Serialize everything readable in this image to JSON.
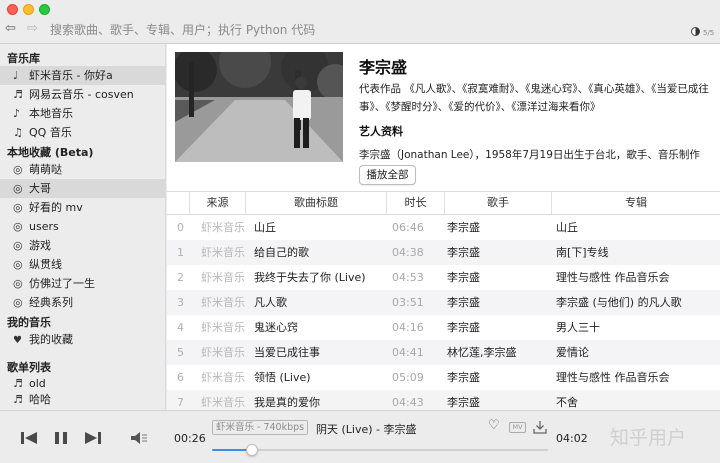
{
  "search": {
    "placeholder": "搜索歌曲、歌手、专辑、用户；执行 Python 代码"
  },
  "toolbar": {
    "page_counter": "5/5"
  },
  "sidebar": {
    "sections": [
      {
        "title": "音乐库",
        "items": [
          {
            "icon": "♩",
            "label": "虾米音乐 - 你好a",
            "selected": true
          },
          {
            "icon": "♬",
            "label": "网易云音乐 - cosven",
            "selected": false
          },
          {
            "icon": "♪",
            "label": "本地音乐",
            "selected": false
          },
          {
            "icon": "♫",
            "label": "QQ 音乐",
            "selected": false
          }
        ]
      },
      {
        "title": "本地收藏 (Beta)",
        "items": [
          {
            "icon": "◎",
            "label": "萌萌哒",
            "selected": false
          },
          {
            "icon": "◎",
            "label": "大哥",
            "selected": true
          },
          {
            "icon": "◎",
            "label": "好看的 mv",
            "selected": false
          },
          {
            "icon": "◎",
            "label": "users",
            "selected": false
          },
          {
            "icon": "◎",
            "label": "游戏",
            "selected": false
          },
          {
            "icon": "◎",
            "label": "纵贯线",
            "selected": false
          },
          {
            "icon": "◎",
            "label": "仿佛过了一生",
            "selected": false
          },
          {
            "icon": "◎",
            "label": "经典系列",
            "selected": false
          }
        ]
      },
      {
        "title": "我的音乐",
        "items": [
          {
            "icon": "♥",
            "label": "我的收藏",
            "selected": false
          }
        ]
      },
      {
        "title": "歌单列表",
        "items": [
          {
            "icon": "♬",
            "label": "old",
            "selected": false
          },
          {
            "icon": "♬",
            "label": "哈哈",
            "selected": false
          }
        ]
      }
    ]
  },
  "artist": {
    "name": "李宗盛",
    "works": "代表作品 《凡人歌》、《寂寞难耐》、《鬼迷心窍》、《真心英雄》、《当爱已成往事》、《梦醒时分》、《爱的代价》、《漂洋过海来看你》",
    "info_title": "艺人资料",
    "bio": "李宗盛（Jonathan Lee），1958年7月19日出生于台北，歌手、音乐制作",
    "play_all_label": "播放全部"
  },
  "table": {
    "headers": [
      "",
      "来源",
      "歌曲标题",
      "时长",
      "歌手",
      "专辑"
    ],
    "rows": [
      {
        "index": "0",
        "source": "虾米音乐",
        "title": "山丘",
        "duration": "06:46",
        "artist": "李宗盛",
        "album": "山丘"
      },
      {
        "index": "1",
        "source": "虾米音乐",
        "title": "给自己的歌",
        "duration": "04:38",
        "artist": "李宗盛",
        "album": "南[下]专线"
      },
      {
        "index": "2",
        "source": "虾米音乐",
        "title": "我终于失去了你 (Live)",
        "duration": "04:53",
        "artist": "李宗盛",
        "album": "理性与感性 作品音乐会"
      },
      {
        "index": "3",
        "source": "虾米音乐",
        "title": "凡人歌",
        "duration": "03:51",
        "artist": "李宗盛",
        "album": "李宗盛 (与他们) 的凡人歌"
      },
      {
        "index": "4",
        "source": "虾米音乐",
        "title": "鬼迷心窍",
        "duration": "04:16",
        "artist": "李宗盛",
        "album": "男人三十"
      },
      {
        "index": "5",
        "source": "虾米音乐",
        "title": "当爱已成往事",
        "duration": "04:41",
        "artist": "林忆莲,李宗盛",
        "album": "爱情论"
      },
      {
        "index": "6",
        "source": "虾米音乐",
        "title": "领悟 (Live)",
        "duration": "05:09",
        "artist": "李宗盛",
        "album": "理性与感性 作品音乐会"
      },
      {
        "index": "7",
        "source": "虾米音乐",
        "title": "我是真的爱你",
        "duration": "04:43",
        "artist": "李宗盛",
        "album": "不舍"
      }
    ]
  },
  "player": {
    "current_time": "00:26",
    "total_time": "04:02",
    "source_badge": "虾米音乐 - 740kbps",
    "now_playing": "阴天 (Live) - 李宗盛",
    "mv_label": "MV",
    "progress": 0.12,
    "watermark": "知乎用户"
  },
  "colors": {
    "accent": "#3a8ee6",
    "selected_row": "#d9d9d9",
    "alt_row": "#f4f4f6"
  }
}
